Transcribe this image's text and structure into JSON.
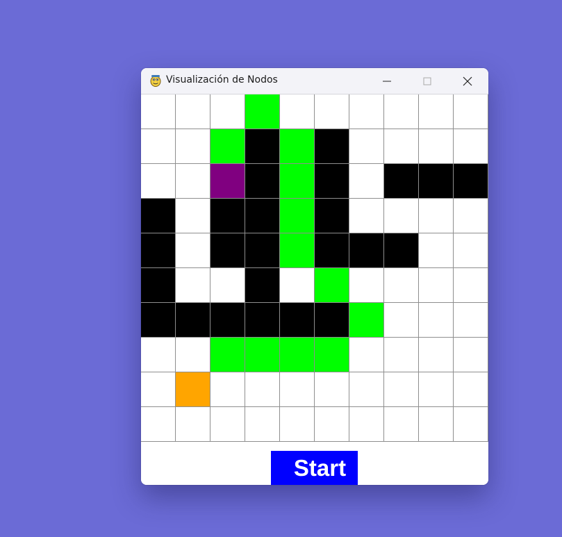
{
  "window": {
    "title": "Visualización de Nodos",
    "controls": {
      "minimize_icon": "minimize-icon",
      "maximize_icon": "maximize-icon",
      "close_icon": "close-icon"
    },
    "app_icon": "python-snake-icon"
  },
  "palette": {
    "background": "#6b6bd6",
    "empty": "#ffffff",
    "wall": "#000000",
    "path": "#00ff00",
    "start": "#800080",
    "end": "#ffa500",
    "grid_line": "#8e8e8e",
    "button": "#0000ff"
  },
  "legend_codes": {
    "E": "empty",
    "W": "wall",
    "P": "path",
    "S": "start",
    "G": "end"
  },
  "grid": {
    "rows": [
      [
        "E",
        "E",
        "E",
        "P",
        "E",
        "E",
        "E",
        "E",
        "E",
        "E"
      ],
      [
        "E",
        "E",
        "P",
        "W",
        "P",
        "W",
        "E",
        "E",
        "E",
        "E"
      ],
      [
        "E",
        "E",
        "S",
        "W",
        "P",
        "W",
        "E",
        "W",
        "W",
        "W"
      ],
      [
        "W",
        "E",
        "W",
        "W",
        "P",
        "W",
        "E",
        "E",
        "E",
        "E"
      ],
      [
        "W",
        "E",
        "W",
        "W",
        "P",
        "W",
        "W",
        "W",
        "E",
        "E"
      ],
      [
        "W",
        "E",
        "E",
        "W",
        "E",
        "P",
        "E",
        "E",
        "E",
        "E"
      ],
      [
        "W",
        "W",
        "W",
        "W",
        "W",
        "W",
        "P",
        "E",
        "E",
        "E"
      ],
      [
        "E",
        "E",
        "P",
        "P",
        "P",
        "P",
        "E",
        "E",
        "E",
        "E"
      ],
      [
        "E",
        "G",
        "E",
        "E",
        "E",
        "E",
        "E",
        "E",
        "E",
        "E"
      ],
      [
        "E",
        "E",
        "E",
        "E",
        "E",
        "E",
        "E",
        "E",
        "E",
        "E"
      ]
    ]
  },
  "controls": {
    "start_label": "Start"
  }
}
